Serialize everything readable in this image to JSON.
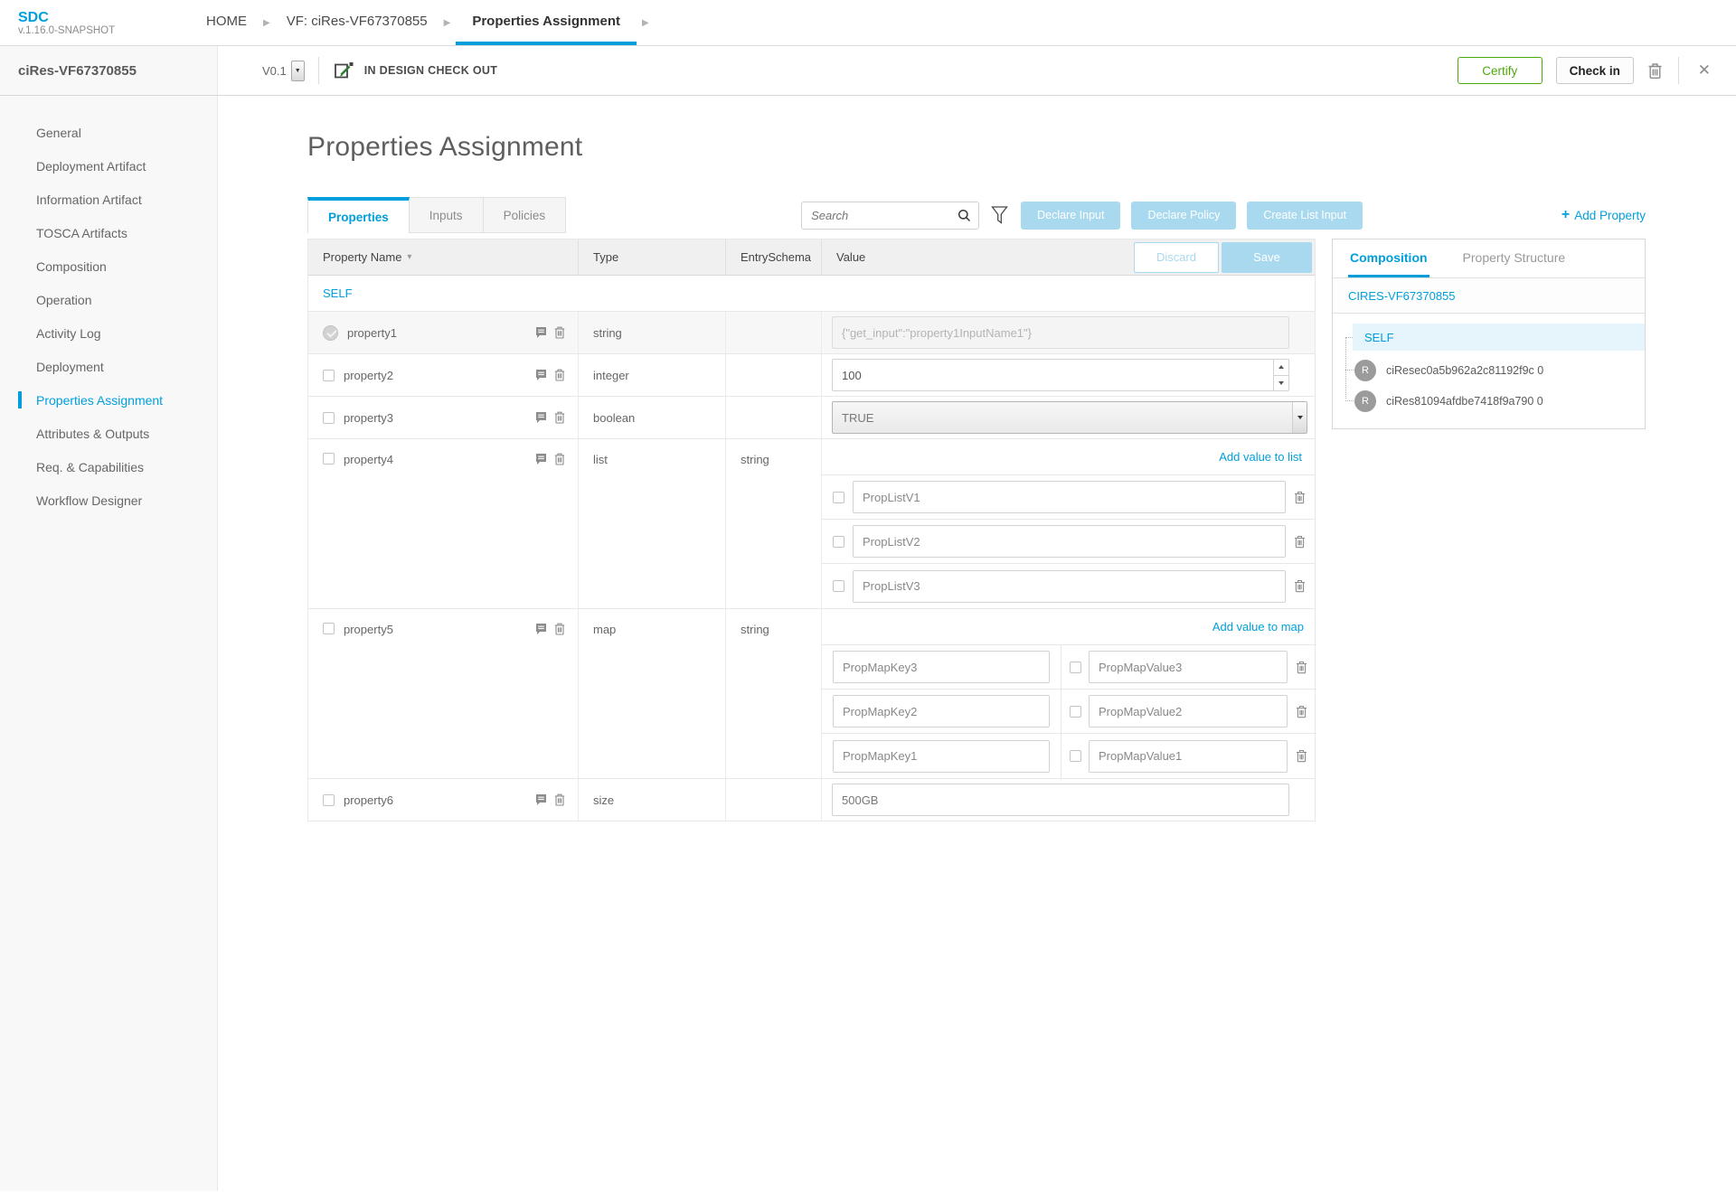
{
  "colors": {
    "accent": "#009fdb",
    "light_blue": "#a9d9ee",
    "certify_green": "#4ca90c"
  },
  "topnav": {
    "logo_title": "SDC",
    "logo_version": "v.1.16.0-SNAPSHOT",
    "breadcrumbs": [
      {
        "label": "HOME"
      },
      {
        "label": "VF: ciRes-VF67370855"
      },
      {
        "label": "Properties Assignment"
      }
    ]
  },
  "toolbar": {
    "entity_name": "ciRes-VF67370855",
    "version": "V0.1",
    "status": "IN DESIGN CHECK OUT",
    "certify_label": "Certify",
    "checkin_label": "Check in"
  },
  "sidebar": {
    "items": [
      "General",
      "Deployment Artifact",
      "Information Artifact",
      "TOSCA Artifacts",
      "Composition",
      "Operation",
      "Activity Log",
      "Deployment",
      "Properties Assignment",
      "Attributes & Outputs",
      "Req. & Capabilities",
      "Workflow Designer"
    ],
    "active": "Properties Assignment"
  },
  "main": {
    "title": "Properties Assignment",
    "tabs": [
      "Properties",
      "Inputs",
      "Policies"
    ],
    "active_tab": "Properties",
    "search_placeholder": "Search",
    "declare_input_label": "Declare Input",
    "declare_policy_label": "Declare Policy",
    "create_list_input_label": "Create List Input",
    "add_property_plus": "+",
    "add_property_label": "Add Property",
    "table": {
      "col_property_name": "Property Name",
      "col_type": "Type",
      "col_entry_schema": "EntrySchema",
      "col_value": "Value",
      "sort_caret": "▾",
      "discard_label": "Discard",
      "save_label": "Save",
      "group_label": "SELF",
      "rows": [
        {
          "name": "property1",
          "type": "string",
          "entry_schema": "",
          "value": "{\"get_input\":\"property1InputName1\"}"
        },
        {
          "name": "property2",
          "type": "integer",
          "entry_schema": "",
          "value": "100"
        },
        {
          "name": "property3",
          "type": "boolean",
          "entry_schema": "",
          "value": "TRUE"
        },
        {
          "name": "property4",
          "type": "list",
          "entry_schema": "string",
          "add_link": "Add value to list",
          "items": [
            "PropListV1",
            "PropListV2",
            "PropListV3"
          ]
        },
        {
          "name": "property5",
          "type": "map",
          "entry_schema": "string",
          "add_link": "Add value to map",
          "entries": [
            {
              "key": "PropMapKey3",
              "value": "PropMapValue3"
            },
            {
              "key": "PropMapKey2",
              "value": "PropMapValue2"
            },
            {
              "key": "PropMapKey1",
              "value": "PropMapValue1"
            }
          ]
        },
        {
          "name": "property6",
          "type": "size",
          "entry_schema": "",
          "value": "500GB"
        }
      ]
    }
  },
  "right_panel": {
    "tabs": [
      "Composition",
      "Property Structure"
    ],
    "active_tab": "Composition",
    "root_label": "CIRES-VF67370855",
    "self_label": "SELF",
    "children": [
      {
        "initial": "R",
        "label": "ciResec0a5b962a2c81192f9c 0"
      },
      {
        "initial": "R",
        "label": "ciRes81094afdbe7418f9a790 0"
      }
    ]
  },
  "glyphs": {
    "breadcrumb_arrow": "▶",
    "close": "✕",
    "select_caret": "▼"
  }
}
